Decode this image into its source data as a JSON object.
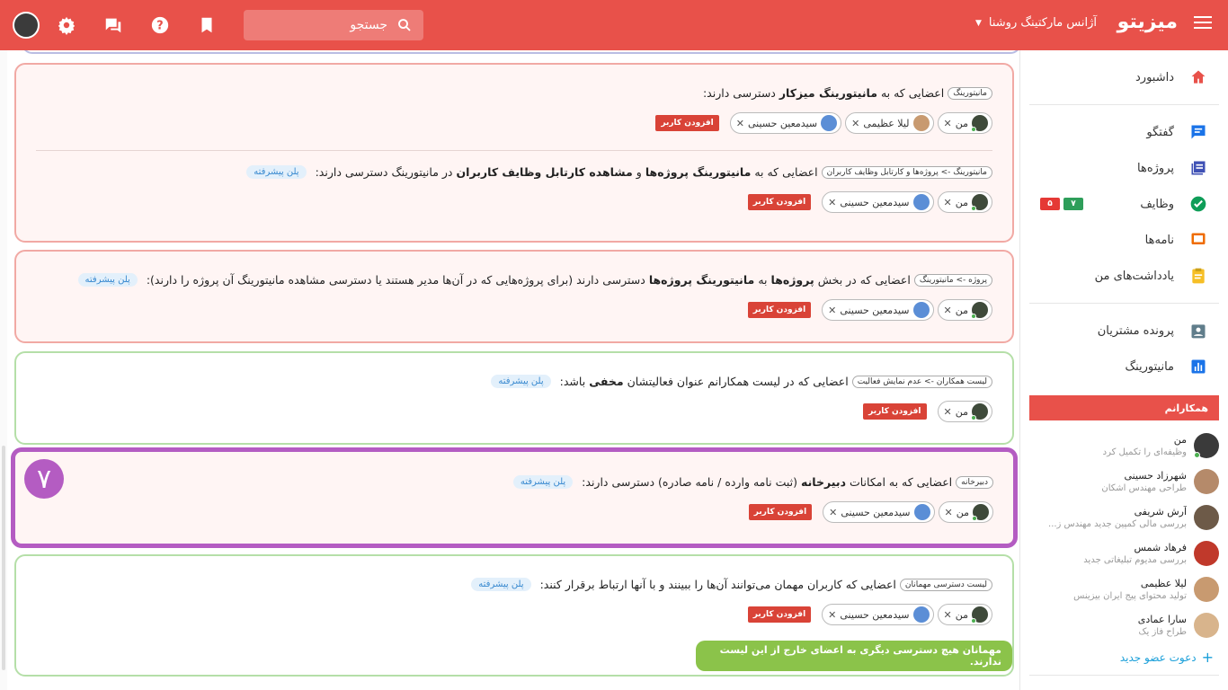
{
  "header": {
    "brand": "میزیتو",
    "agency": "آژانس مارکتینگ روشنا",
    "search_placeholder": "جستجو",
    "icons": [
      "menu-icon",
      "search-icon",
      "bookmark-icon",
      "help-icon",
      "chat-icon",
      "settings-icon",
      "avatar"
    ]
  },
  "sidebar": {
    "items": [
      {
        "label": "داشبورد",
        "icon": "home-icon",
        "color": "#e8514a"
      },
      {
        "label": "گفتگو",
        "icon": "chat-icon",
        "color": "#1a73e8"
      },
      {
        "label": "پروژه‌ها",
        "icon": "projects-icon",
        "color": "#3f51b5"
      },
      {
        "label": "وظایف",
        "icon": "check-icon",
        "color": "#0f9d58"
      },
      {
        "label": "نامه‌ها",
        "icon": "letter-icon",
        "color": "#ef6c00"
      },
      {
        "label": "یادداشت‌های من",
        "icon": "note-icon",
        "color": "#f6bf26"
      },
      {
        "label": "پرونده مشتریان",
        "icon": "client-icon",
        "color": "#607d8b"
      },
      {
        "label": "مانیتورینگ",
        "icon": "chart-icon",
        "color": "#1a73e8"
      }
    ],
    "task_badges": [
      "۷",
      "۵"
    ],
    "task_badge_colors": [
      "#2e9e5a",
      "#e53935"
    ],
    "team_title": "همکارانم",
    "members": [
      {
        "name": "من",
        "role": "وظیفه‌ای را تکمیل کرد"
      },
      {
        "name": "شهرزاد حسینی",
        "role": "طراحی مهندس اشکان"
      },
      {
        "name": "آرش شریفی",
        "role": "بررسی مالی کمپین جدید مهندس ز..."
      },
      {
        "name": "فرهاد شمس",
        "role": "بررسی مدیوم تبلیغاتی جدید"
      },
      {
        "name": "لیلا عظیمی",
        "role": "تولید محتوای پیج ایران بیزینس"
      },
      {
        "name": "سارا عمادی",
        "role": "طراح فاز یک"
      }
    ],
    "invite": "دعوت عضو جدید"
  },
  "common": {
    "add_user": "افزودن کاربر",
    "advanced_plan": "پلن پیشرفته",
    "me": "من",
    "user_sm": "سیدمعین حسینی",
    "user_la": "لیلا عظیمی"
  },
  "cards": {
    "c1a": {
      "tag": "مانیتورینگ",
      "p1": "اعضایی که به",
      "b1": "مانیتورینگ میزکار",
      "p2": "دسترسی دارند:"
    },
    "c1b": {
      "tag": "مانیتورینگ -> پروژه‌ها و کارتابل وظایف کاربران",
      "p1": "اعضایی که به",
      "b1": "مانیتورینگ پروژه‌ها",
      "p2": "و",
      "b2": "مشاهده کارتابل وظایف کاربران",
      "p3": "در مانیتورینگ دسترسی دارند:"
    },
    "c2": {
      "tag": "پروژه -> مانیتورینگ",
      "p1": "اعضایی که در بخش",
      "b1": "پروژه‌ها",
      "p2": "به",
      "b2": "مانیتورینگ پروژه‌ها",
      "p3": "دسترسی دارند (برای پروژه‌هایی که در آن‌ها مدیر هستند یا دسترسی مشاهده مانیتورینگ آن پروژه را دارند):"
    },
    "c3": {
      "tag": "لیست همکاران -> عدم نمایش فعالیت",
      "p1": "اعضایی که در لیست همکارانم عنوان فعالیتشان",
      "b1": "مخفی",
      "p2": "باشد:"
    },
    "c4": {
      "step": "۷",
      "tag": "دبیرخانه",
      "p1": "اعضایی که به امکانات",
      "b1": "دبیرخانه",
      "p2": "(ثبت نامه وارده / نامه صادره) دسترسی دارند:"
    },
    "c5": {
      "tag": "لیست دسترسی مهمانان",
      "p1": "اعضایی که کاربران مهمان می‌توانند آن‌ها را ببینند و با آنها ارتباط برقرار کنند:",
      "notice": "مهمانان هیچ دسترسی دیگری به اعضای خارج از این لیست ندارند."
    }
  }
}
